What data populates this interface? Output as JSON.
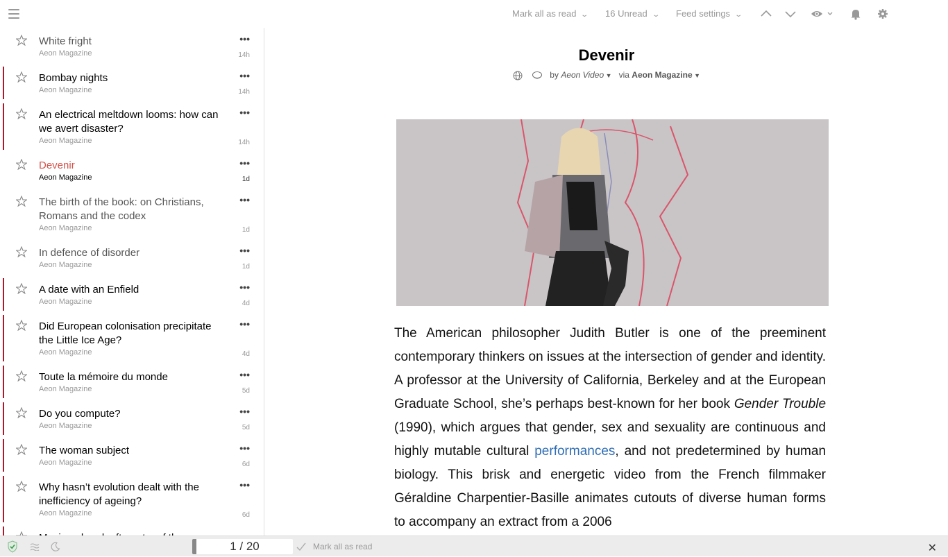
{
  "toolbar": {
    "mark_all_label": "Mark all as read",
    "unread_label": "16 Unread",
    "feed_settings_label": "Feed settings"
  },
  "items": [
    {
      "title": "White fright",
      "feed": "Aeon Magazine",
      "time": "14h"
    },
    {
      "title": "Bombay nights",
      "feed": "Aeon Magazine",
      "time": "14h"
    },
    {
      "title": "An electrical meltdown looms: how can we avert disaster?",
      "feed": "Aeon Magazine",
      "time": "14h"
    },
    {
      "title": "Devenir",
      "feed": "Aeon Magazine",
      "time": "1d"
    },
    {
      "title": "The birth of the book: on Christians, Romans and the codex",
      "feed": "Aeon Magazine",
      "time": "1d"
    },
    {
      "title": "In defence of disorder",
      "feed": "Aeon Magazine",
      "time": "1d"
    },
    {
      "title": "A date with an Enfield",
      "feed": "Aeon Magazine",
      "time": "4d"
    },
    {
      "title": "Did European colonisation precipitate the Little Ice Age?",
      "feed": "Aeon Magazine",
      "time": "4d"
    },
    {
      "title": "Toute la mémoire du monde",
      "feed": "Aeon Magazine",
      "time": "5d"
    },
    {
      "title": "Do you compute?",
      "feed": "Aeon Magazine",
      "time": "5d"
    },
    {
      "title": "The woman subject",
      "feed": "Aeon Magazine",
      "time": "6d"
    },
    {
      "title": "Why hasn’t evolution dealt with the inefficiency of ageing?",
      "feed": "Aeon Magazine",
      "time": "6d"
    },
    {
      "title": "Mocing ahead: after a t... af th...",
      "feed": "",
      "time": ""
    }
  ],
  "article": {
    "title": "Devenir",
    "by_label": "by",
    "author": "Aeon Video",
    "via_label": "via",
    "feed": "Aeon Magazine",
    "body_p1": "The American philosopher Judith Butler is one of the preeminent contemporary thinkers on issues at the intersection of gender and identity. A professor at the University of California, Berkeley and at the European Graduate School, she’s perhaps best-known for her book",
    "body_book": "Gender Trouble",
    "body_p2": "(1990), which argues that gender, sex and sexuality are continuous and highly mutable cultural",
    "body_link": "performances",
    "body_p3": ", and not predetermined by human biology. This brisk and energetic video from the French filmmaker Géraldine Charpentier-Basille animates cutouts of diverse human forms to accompany an extract from a 2006"
  },
  "bottom": {
    "pager": "1 / 20",
    "mark_all_label": "Mark all as read"
  },
  "colors": {
    "unread_bar": "#b0182a",
    "active_title": "#d5534a",
    "link": "#2e6db5"
  },
  "icons": {
    "menu": "hamburger-icon",
    "prev": "chevron-up-icon",
    "next": "chevron-down-icon",
    "view": "eye-icon",
    "notify": "bell-icon",
    "settings": "gear-icon",
    "star": "star-icon",
    "more": "ellipsis-icon"
  }
}
